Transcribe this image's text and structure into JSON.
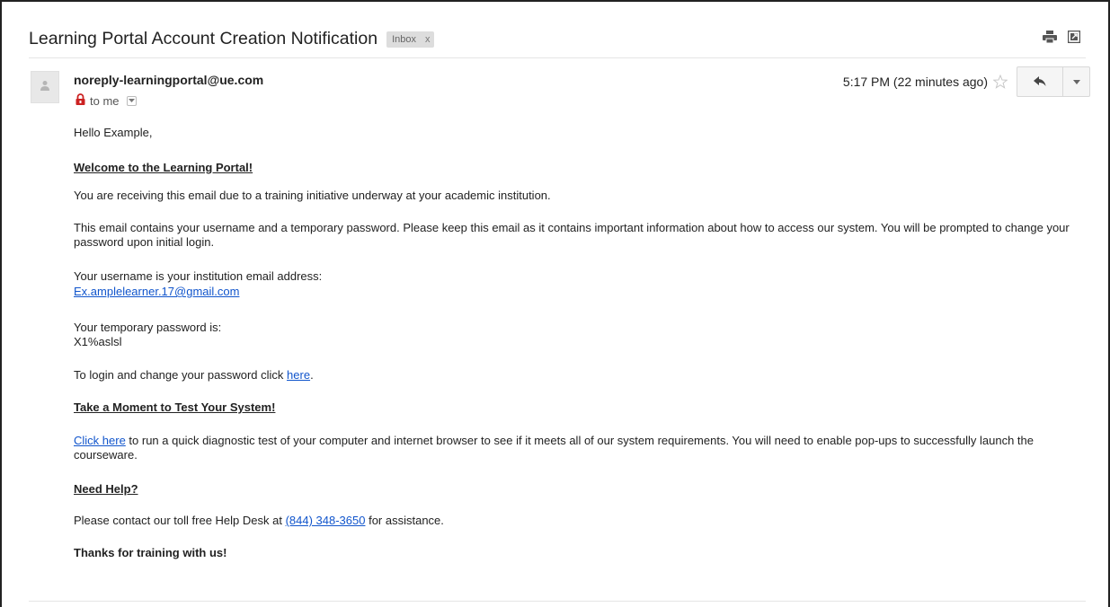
{
  "email": {
    "subject": "Learning Portal Account Creation Notification",
    "label": "Inbox",
    "label_remove": "x",
    "sender": "noreply-learningportal@ue.com",
    "to": "to me",
    "time": "5:17 PM (22 minutes ago)"
  },
  "icons": {
    "print": "print-icon",
    "popout": "new-window-icon",
    "lock": "lock-icon",
    "star": "star-icon",
    "reply": "reply-icon",
    "more": "chevron-down-icon",
    "avatar": "person-icon"
  },
  "colors": {
    "link": "#1155cc",
    "lock": "#cc2222",
    "label_bg": "#dddddd"
  },
  "message": {
    "greeting": "Hello Example,",
    "welcome_heading": "Welcome to the Learning Portal!",
    "intro": "You are receiving this email due to a training initiative underway at your academic institution.",
    "info": "This email contains your username and a temporary password. Please keep this email as it contains important information about how to access our system. You will be prompted to change your password upon initial login.",
    "username_label": "Your username is your institution email address:",
    "username": "Ex.amplelearner.17@gmail.com",
    "password_label": "Your temporary password is:",
    "password": "X1%aslsl",
    "login_prefix": "To login and change your password click ",
    "login_link": "here",
    "login_suffix": ".",
    "test_heading": "Take a Moment to Test Your System!",
    "test_link": "Click here",
    "test_text": " to run a quick diagnostic test of your computer and internet browser to see if it meets all of our system requirements. You will need to enable pop-ups to successfully launch the courseware.",
    "help_heading": "Need Help?",
    "help_prefix": "Please contact our toll free Help Desk at ",
    "help_phone": "(844) 348-3650",
    "help_suffix": " for assistance.",
    "thanks": "Thanks for training with us!"
  }
}
